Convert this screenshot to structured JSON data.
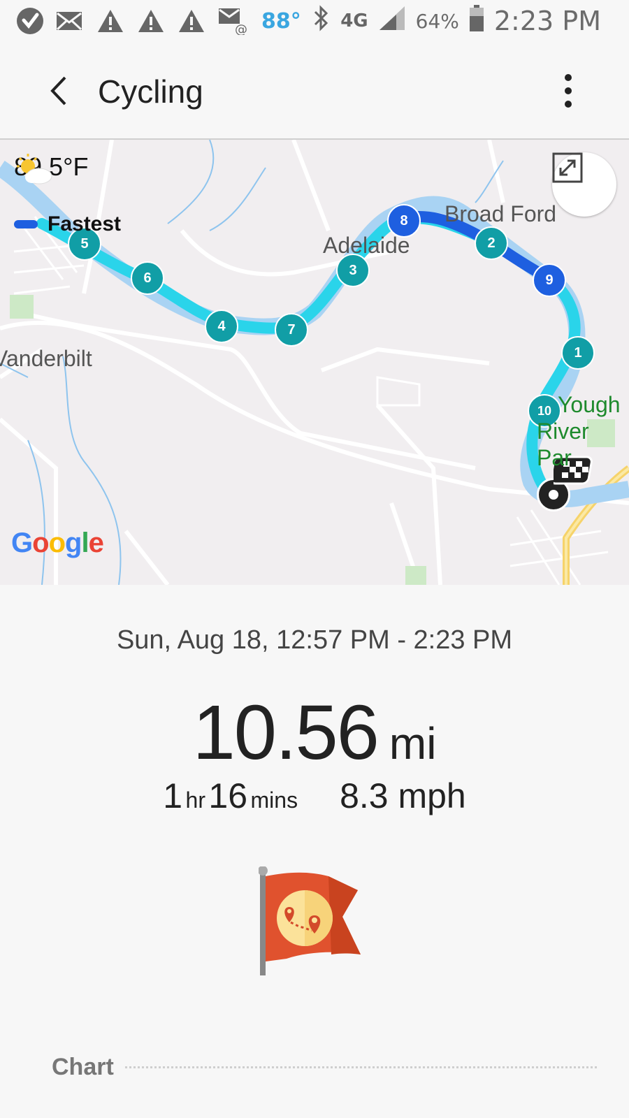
{
  "status_bar": {
    "icons": [
      "verizon-check-icon",
      "mail-icon",
      "alert-icon",
      "alert-icon",
      "alert-icon",
      "mail-at-icon"
    ],
    "temperature": "88°",
    "network": "4G",
    "battery_pct": "64%",
    "time": "2:23 PM"
  },
  "app_bar": {
    "title": "Cycling"
  },
  "map": {
    "weather_text": "89.5°F",
    "legend_label": "Fastest",
    "places": {
      "broad_ford": "Broad Ford",
      "adelaide": "Adelaide",
      "vanderbilt": "Vanderbilt",
      "yough_line1": "Yough",
      "yough_line2": "River Par"
    },
    "google": [
      "G",
      "o",
      "o",
      "g",
      "l",
      "e"
    ],
    "google_colors": [
      "#4285f4",
      "#ea4335",
      "#fbbc05",
      "#4285f4",
      "#34a853",
      "#ea4335"
    ],
    "markers": [
      {
        "label": "1",
        "fastest": false
      },
      {
        "label": "2",
        "fastest": false
      },
      {
        "label": "3",
        "fastest": false
      },
      {
        "label": "4",
        "fastest": false
      },
      {
        "label": "5",
        "fastest": false
      },
      {
        "label": "6",
        "fastest": false
      },
      {
        "label": "7",
        "fastest": false
      },
      {
        "label": "8",
        "fastest": true
      },
      {
        "label": "9",
        "fastest": true
      },
      {
        "label": "10",
        "fastest": false
      }
    ],
    "route_color": "#2ad4ea",
    "fastest_color": "#1e5fe0",
    "marker_color": "#119ea6"
  },
  "summary": {
    "date_range": "Sun, Aug 18, 12:57 PM - 2:23 PM",
    "distance_value": "10.56",
    "distance_unit": "mi",
    "duration_hr": "1",
    "duration_hr_unit": "hr",
    "duration_min": "16",
    "duration_min_unit": "mins",
    "speed": "8.3 mph"
  },
  "chart_section": {
    "label": "Chart"
  }
}
